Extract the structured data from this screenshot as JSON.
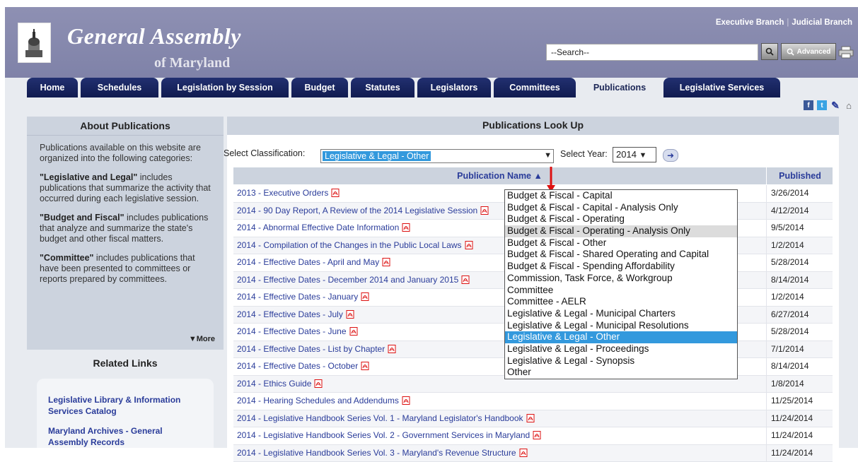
{
  "header": {
    "title": "General Assembly",
    "subtitle": "of Maryland",
    "top_links": [
      "Executive Branch",
      "Judicial Branch"
    ],
    "search_value": "--Search--",
    "advanced_label": "Advanced"
  },
  "nav": [
    {
      "label": "Home",
      "width": 72
    },
    {
      "label": "Schedules",
      "width": 110
    },
    {
      "label": "Legislation by Session",
      "width": 180
    },
    {
      "label": "Budget",
      "width": 80
    },
    {
      "label": "Statutes",
      "width": 90
    },
    {
      "label": "Legislators",
      "width": 104
    },
    {
      "label": "Committees",
      "width": 116
    },
    {
      "label": "Publications",
      "width": 116
    },
    {
      "label": "Legislative Services",
      "width": 165
    }
  ],
  "active_tab": "Publications",
  "sidebar": {
    "about_title": "About Publications",
    "intro": "Publications available on this website are organized into the following categories:",
    "cat1_bold": "\"Legislative and Legal\"",
    "cat1_text": " includes publications that summarize the activity that occurred during each legislative session.",
    "cat2_bold": "\"Budget and Fiscal\"",
    "cat2_text": " includes publications that analyze and summarize the state's budget and other fiscal matters.",
    "cat3_bold": "\"Committee\"",
    "cat3_text": " includes publications that have been presented to committees or reports prepared by committees.",
    "more_label": "▼More",
    "related_title": "Related Links",
    "links": [
      "Legislative Library & Information Services Catalog",
      "Maryland Archives - General Assembly Records"
    ]
  },
  "main": {
    "title": "Publications Look Up",
    "classification_label": "Select Classification:",
    "classification_value": "Legislative & Legal - Other",
    "year_label": "Select Year:",
    "year_value": "2014",
    "col_name": "Publication Name ▲",
    "col_published": "Published",
    "rows": [
      {
        "name": "2013 - Executive Orders",
        "date": "3/26/2014"
      },
      {
        "name": "2014 - 90 Day Report, A Review of the 2014 Legislative Session",
        "date": "4/12/2014"
      },
      {
        "name": "2014 - Abnormal Effective Date Information",
        "date": "9/5/2014"
      },
      {
        "name": "2014 - Compilation of the Changes in the Public Local Laws",
        "date": "1/2/2014"
      },
      {
        "name": "2014 - Effective Dates - April and May",
        "date": "5/28/2014"
      },
      {
        "name": "2014 - Effective Dates - December 2014 and January 2015",
        "date": "8/14/2014"
      },
      {
        "name": "2014 - Effective Dates - January",
        "date": "1/2/2014"
      },
      {
        "name": "2014 - Effective Dates - July",
        "date": "6/27/2014"
      },
      {
        "name": "2014 - Effective Dates - June",
        "date": "5/28/2014"
      },
      {
        "name": "2014 - Effective Dates - List by Chapter",
        "date": "7/1/2014"
      },
      {
        "name": "2014 - Effective Dates - October",
        "date": "8/14/2014"
      },
      {
        "name": "2014 - Ethics Guide",
        "date": "1/8/2014"
      },
      {
        "name": "2014 - Hearing Schedules and Addendums",
        "date": "11/25/2014"
      },
      {
        "name": "2014 - Legislative Handbook Series Vol. 1 - Maryland Legislator's Handbook",
        "date": "11/24/2014"
      },
      {
        "name": "2014 - Legislative Handbook Series Vol. 2 - Government Services in Maryland",
        "date": "11/24/2014"
      },
      {
        "name": "2014 - Legislative Handbook Series Vol. 3 - Maryland's Revenue Structure",
        "date": "11/24/2014"
      }
    ],
    "dropdown_options": [
      "Budget & Fiscal - Capital",
      "Budget & Fiscal - Capital - Analysis Only",
      "Budget & Fiscal - Operating",
      "Budget & Fiscal - Operating - Analysis Only",
      "Budget & Fiscal - Other",
      "Budget & Fiscal - Shared Operating and Capital",
      "Budget & Fiscal - Spending Affordability",
      "Commission, Task Force, & Workgroup",
      "Committee",
      "Committee - AELR",
      "Legislative & Legal - Municipal Charters",
      "Legislative & Legal - Municipal Resolutions",
      "Legislative & Legal - Other",
      "Legislative & Legal - Proceedings",
      "Legislative & Legal - Synopsis",
      "Other"
    ],
    "dropdown_hover": "Budget & Fiscal - Operating - Analysis Only",
    "dropdown_selected": "Legislative & Legal - Other"
  },
  "colors": {
    "accent": "#2a3c9a",
    "nav": "#16205a",
    "selected": "#3399dd",
    "header": "#8688ad"
  }
}
